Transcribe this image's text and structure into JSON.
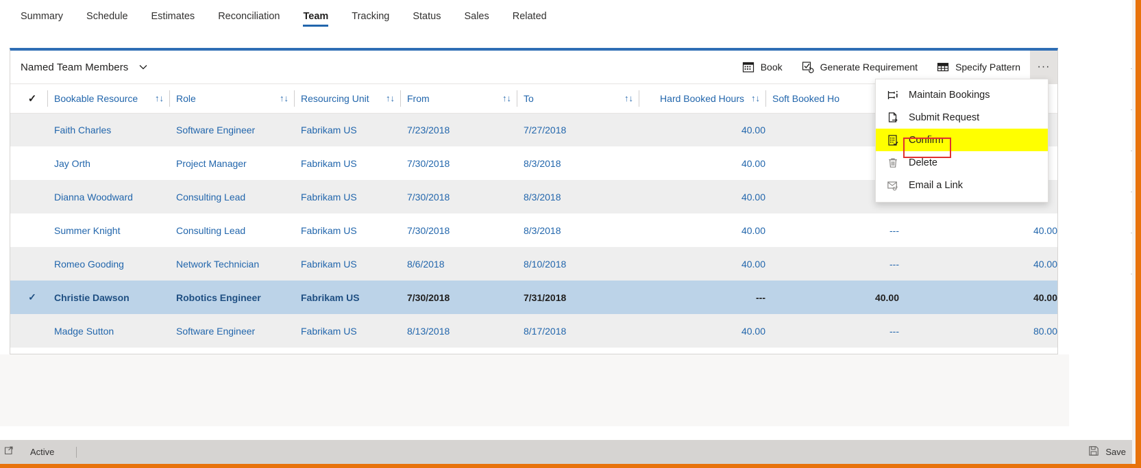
{
  "tabs": [
    {
      "label": "Summary",
      "active": false
    },
    {
      "label": "Schedule",
      "active": false
    },
    {
      "label": "Estimates",
      "active": false
    },
    {
      "label": "Reconciliation",
      "active": false
    },
    {
      "label": "Team",
      "active": true
    },
    {
      "label": "Tracking",
      "active": false
    },
    {
      "label": "Status",
      "active": false
    },
    {
      "label": "Sales",
      "active": false
    },
    {
      "label": "Related",
      "active": false
    }
  ],
  "panel": {
    "title": "Named Team Members",
    "commands": [
      {
        "label": "Book",
        "icon": "calendar-icon"
      },
      {
        "label": "Generate Requirement",
        "icon": "generate-requirement-icon"
      },
      {
        "label": "Specify Pattern",
        "icon": "grid-pattern-icon"
      }
    ],
    "more_label": "···"
  },
  "grid": {
    "columns": [
      {
        "label": "",
        "key": "check",
        "type": "check",
        "sortable": false
      },
      {
        "label": "Bookable Resource",
        "key": "resource",
        "type": "link",
        "sortable": true
      },
      {
        "label": "Role",
        "key": "role",
        "type": "link",
        "sortable": true
      },
      {
        "label": "Resourcing Unit",
        "key": "unit",
        "type": "link",
        "sortable": true
      },
      {
        "label": "From",
        "key": "from",
        "type": "date",
        "sortable": true
      },
      {
        "label": "To",
        "key": "to",
        "type": "date",
        "sortable": true
      },
      {
        "label": "Hard Booked Hours",
        "key": "hard",
        "type": "num",
        "sortable": true
      },
      {
        "label": "Soft Booked Ho",
        "key": "soft",
        "type": "num",
        "sortable": false
      },
      {
        "label": "",
        "key": "total",
        "type": "num",
        "sortable": false
      }
    ],
    "sort_glyph": "↑↓",
    "check_glyph": "✓",
    "rows": [
      {
        "check": "",
        "resource": "Faith Charles",
        "role": "Software Engineer",
        "unit": "Fabrikam US",
        "from": "7/23/2018",
        "to": "7/27/2018",
        "hard": "40.00",
        "soft": "",
        "total": "",
        "shade": true,
        "selected": false
      },
      {
        "check": "",
        "resource": "Jay Orth",
        "role": "Project Manager",
        "unit": "Fabrikam US",
        "from": "7/30/2018",
        "to": "8/3/2018",
        "hard": "40.00",
        "soft": "",
        "total": "",
        "shade": false,
        "selected": false
      },
      {
        "check": "",
        "resource": "Dianna Woodward",
        "role": "Consulting Lead",
        "unit": "Fabrikam US",
        "from": "7/30/2018",
        "to": "8/3/2018",
        "hard": "40.00",
        "soft": "",
        "total": "",
        "shade": true,
        "selected": false
      },
      {
        "check": "",
        "resource": "Summer Knight",
        "role": "Consulting Lead",
        "unit": "Fabrikam US",
        "from": "7/30/2018",
        "to": "8/3/2018",
        "hard": "40.00",
        "soft": "---",
        "total": "40.00",
        "shade": false,
        "selected": false
      },
      {
        "check": "",
        "resource": "Romeo Gooding",
        "role": "Network Technician",
        "unit": "Fabrikam US",
        "from": "8/6/2018",
        "to": "8/10/2018",
        "hard": "40.00",
        "soft": "---",
        "total": "40.00",
        "shade": true,
        "selected": false
      },
      {
        "check": "✓",
        "resource": "Christie Dawson",
        "role": "Robotics Engineer",
        "unit": "Fabrikam US",
        "from": "7/30/2018",
        "to": "7/31/2018",
        "hard": "---",
        "soft": "40.00",
        "total": "40.00",
        "shade": false,
        "selected": true
      },
      {
        "check": "",
        "resource": "Madge Sutton",
        "role": "Software Engineer",
        "unit": "Fabrikam US",
        "from": "8/13/2018",
        "to": "8/17/2018",
        "hard": "40.00",
        "soft": "---",
        "total": "80.00",
        "shade": true,
        "selected": false
      }
    ]
  },
  "context_menu": {
    "items": [
      {
        "label": "Maintain Bookings",
        "icon": "maintain-bookings-icon",
        "highlighted": false
      },
      {
        "label": "Submit Request",
        "icon": "submit-request-icon",
        "highlighted": false
      },
      {
        "label": "Confirm",
        "icon": "confirm-icon",
        "highlighted": true
      },
      {
        "label": "Delete",
        "icon": "trash-icon",
        "highlighted": false
      },
      {
        "label": "Email a Link",
        "icon": "email-link-icon",
        "highlighted": false
      }
    ]
  },
  "statusbar": {
    "state_label": "Active",
    "save_label": "Save"
  },
  "colors": {
    "accent_blue": "#2266ac",
    "panel_top_border": "#2f6eb5",
    "selected_row": "#bcd3e8",
    "shade_row": "#eeeeee",
    "highlight_yellow": "#ffff00",
    "annotation_red": "#e03030",
    "window_frame_orange": "#e8730c"
  }
}
